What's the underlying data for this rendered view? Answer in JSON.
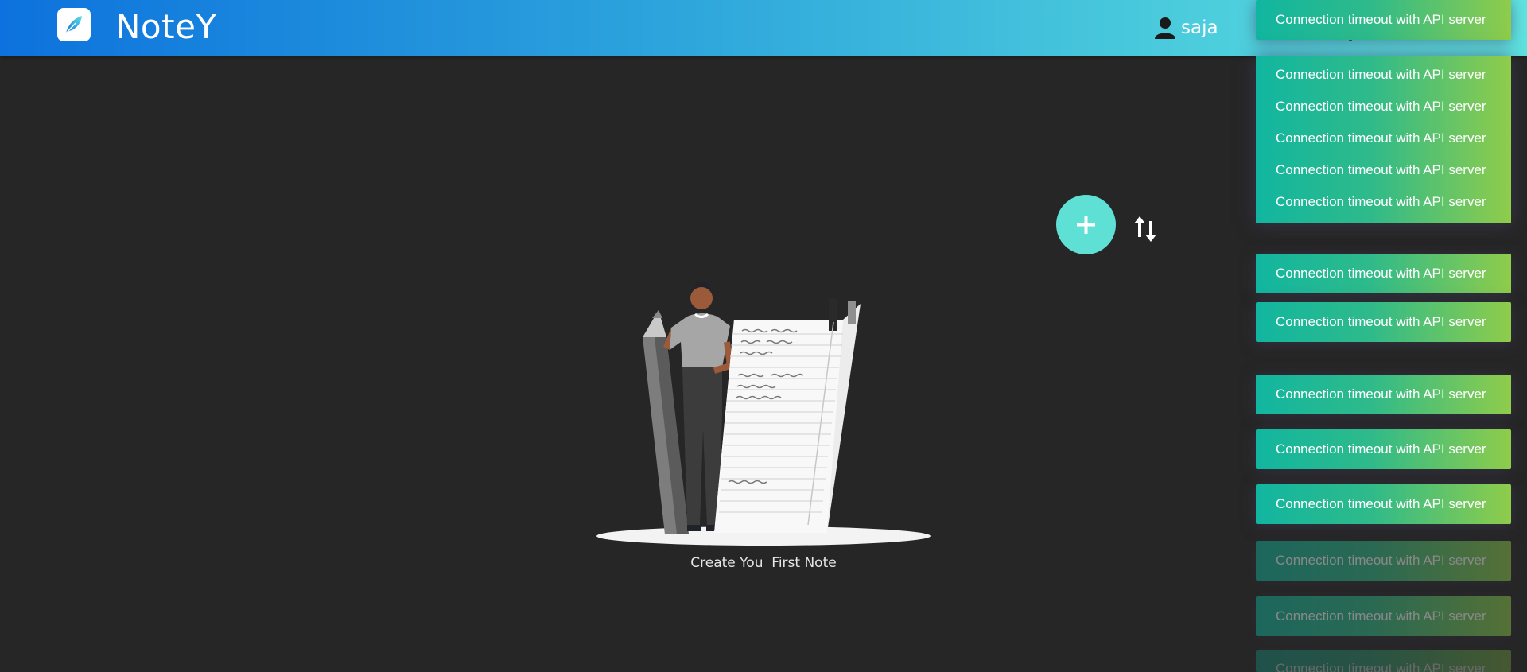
{
  "app": {
    "brand": "NoteY"
  },
  "user": {
    "name": "saja"
  },
  "empty_state": {
    "message": "Create You  First Note"
  },
  "toasts": {
    "message": "Connection timeout with API server",
    "t0": "Connection timeout with API server",
    "t1": "Connection timeout with API server",
    "t2": "Connection timeout with API server",
    "t3": "Connection timeout with API server",
    "t4": "Connection timeout with API server",
    "t5": "Connection timeout with API server",
    "t6": "Connection timeout with API server",
    "t7": "Connection timeout with API server",
    "t8": "Connection timeout with API server",
    "t9": "Connection timeout with API server",
    "t10": "Connection timeout with API server",
    "t11": "Connection timeout with API server",
    "t12": "Connection timeout with API server",
    "t13": "Connection timeout with API server",
    "t14": "Connection timeout with API server"
  },
  "colors": {
    "navbar_start": "#0d72dd",
    "navbar_end": "#5fe3e1",
    "background": "#262626",
    "accent": "#5fe0d4",
    "toast_start": "#11b6a0",
    "toast_end": "#8fcc4a"
  },
  "icons": {
    "logo": "feather-logo-icon",
    "user": "user-icon",
    "add": "plus-icon",
    "sort": "sort-arrows-icon"
  }
}
